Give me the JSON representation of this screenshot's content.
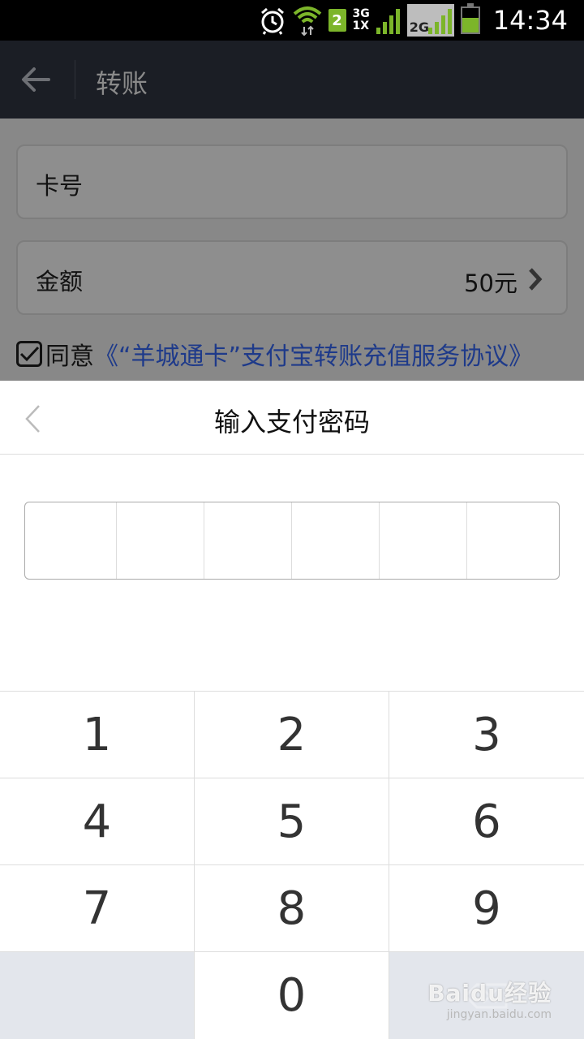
{
  "status_bar": {
    "time": "14:34",
    "sim_number": "2",
    "network_top": "3G",
    "network_bottom": "1X",
    "network_second": "2G",
    "icons": [
      "alarm-icon",
      "wifi-icon",
      "sim-icon",
      "signal-icon",
      "signal-icon",
      "battery-icon"
    ]
  },
  "app_bar": {
    "title": "转账"
  },
  "form": {
    "card_label": "卡号",
    "amount_label": "金额",
    "amount_value": "50元",
    "agree_prefix": "同意",
    "agree_link": "《“羊城通卡”支付宝转账充值服务协议》",
    "agree_checked": true
  },
  "sheet": {
    "title": "输入支付密码",
    "password_length": 6
  },
  "keypad": {
    "keys": [
      "1",
      "2",
      "3",
      "4",
      "5",
      "6",
      "7",
      "8",
      "9",
      "",
      "0",
      ""
    ]
  },
  "watermark": {
    "logo": "Baidu经验",
    "url": "jingyan.baidu.com"
  }
}
